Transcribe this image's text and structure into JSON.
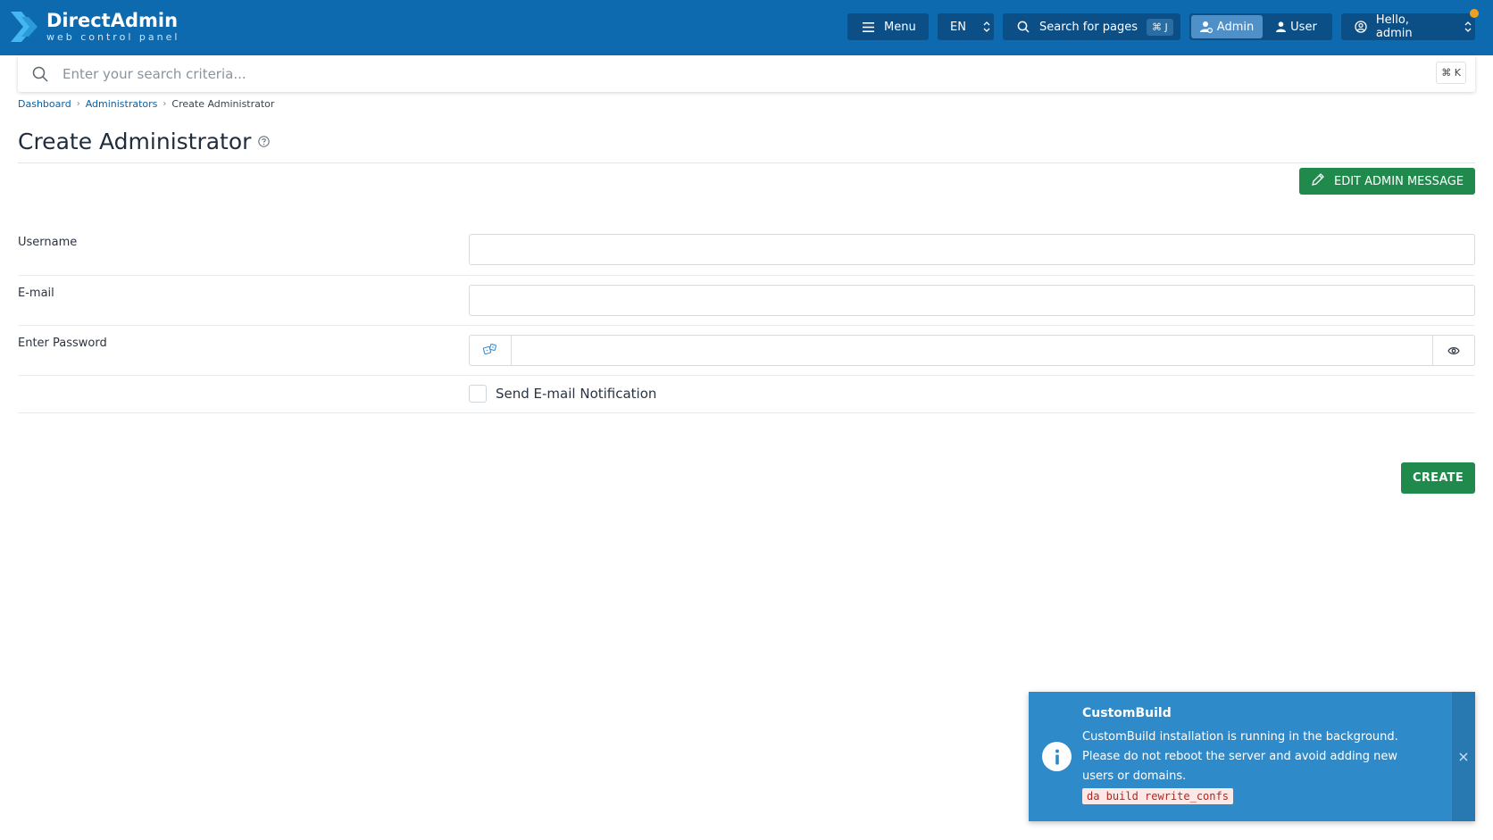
{
  "brand": {
    "title": "DirectAdmin",
    "subtitle": "web control panel"
  },
  "topbar": {
    "menu_label": "Menu",
    "language": "EN",
    "search_label": "Search for pages",
    "search_shortcut": "⌘ J",
    "role_admin": "Admin",
    "role_user": "User",
    "greeting": "Hello, admin"
  },
  "search": {
    "placeholder": "Enter your search criteria...",
    "shortcut": "⌘ K"
  },
  "breadcrumb": {
    "items": [
      "Dashboard",
      "Administrators",
      "Create Administrator"
    ]
  },
  "page": {
    "title": "Create Administrator",
    "edit_message_label": "EDIT ADMIN MESSAGE"
  },
  "form": {
    "username_label": "Username",
    "username_value": "",
    "email_label": "E-mail",
    "email_value": "",
    "password_label": "Enter Password",
    "password_value": "",
    "notify_label": "Send E-mail Notification",
    "submit_label": "CREATE"
  },
  "toast": {
    "title": "CustomBuild",
    "message": "CustomBuild installation is running in the background. Please do not reboot the server and avoid adding new users or domains.",
    "code": "da build rewrite_confs",
    "close": "×"
  },
  "colors": {
    "header": "#0d6aae",
    "primary_button": "#1f8a4c",
    "toast": "#2f8ac9",
    "notification_dot": "#f0a020"
  }
}
